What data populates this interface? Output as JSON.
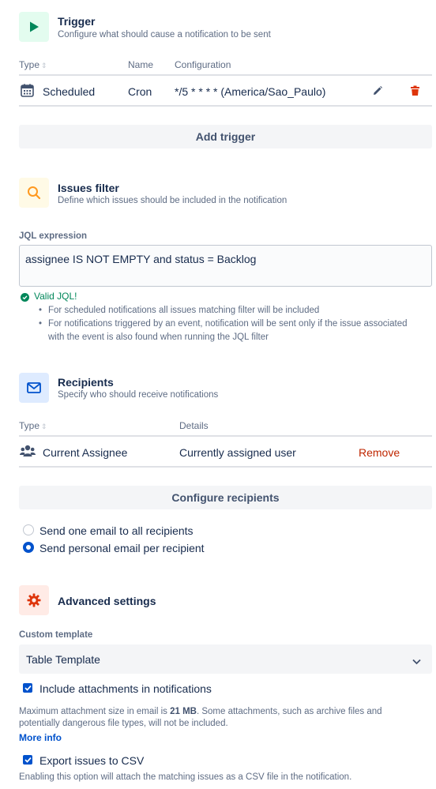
{
  "trigger": {
    "title": "Trigger",
    "description": "Configure what should cause a notification to be sent",
    "icon": "play-icon",
    "columns": [
      "Type",
      "Name",
      "Configuration"
    ],
    "row": {
      "type": "Scheduled",
      "name": "Cron",
      "configuration": "*/5 * * * * (America/Sao_Paulo)"
    },
    "add_button": "Add trigger"
  },
  "issues_filter": {
    "title": "Issues filter",
    "description": "Define which issues should be included in the notification",
    "icon": "search-icon",
    "jql_label": "JQL expression",
    "jql_value": "assignee IS NOT EMPTY and status = Backlog",
    "valid_text": "Valid JQL!",
    "notes": [
      "For scheduled notifications all issues matching filter will be included",
      "For notifications triggered by an event, notification will be sent only if the issue associated with the event is also found when running the JQL filter"
    ]
  },
  "recipients": {
    "title": "Recipients",
    "description": "Specify who should receive notifications",
    "icon": "mail-icon",
    "columns": [
      "Type",
      "Details"
    ],
    "row": {
      "type": "Current Assignee",
      "details": "Currently assigned user",
      "remove": "Remove"
    },
    "configure_button": "Configure recipients",
    "options": [
      {
        "label": "Send one email to all recipients",
        "selected": false
      },
      {
        "label": "Send personal email per recipient",
        "selected": true
      }
    ]
  },
  "advanced": {
    "title": "Advanced settings",
    "icon": "gear-icon",
    "template_label": "Custom template",
    "template_value": "Table Template",
    "include_attachments": {
      "label": "Include attachments in notifications",
      "checked": true,
      "note_prefix": "Maximum attachment size in email is ",
      "note_size": "21 MB",
      "note_suffix": ". Some attachments, such as archive files and potentially dangerous file types, will not be included.",
      "more_info": "More info"
    },
    "export_csv": {
      "label": "Export issues to CSV",
      "checked": true,
      "note": "Enabling this option will attach the matching issues as a CSV file in the notification."
    }
  },
  "colors": {
    "trigger_icon_bg": "#e3fcef",
    "trigger_icon": "#00875a",
    "filter_icon_bg": "#fffae6",
    "filter_icon": "#ff991f",
    "recipients_icon_bg": "#deebff",
    "recipients_icon": "#0052cc",
    "advanced_icon_bg": "#ffebe6",
    "advanced_icon": "#de350b",
    "danger": "#bf2600",
    "link": "#0052cc",
    "success": "#00875a"
  }
}
